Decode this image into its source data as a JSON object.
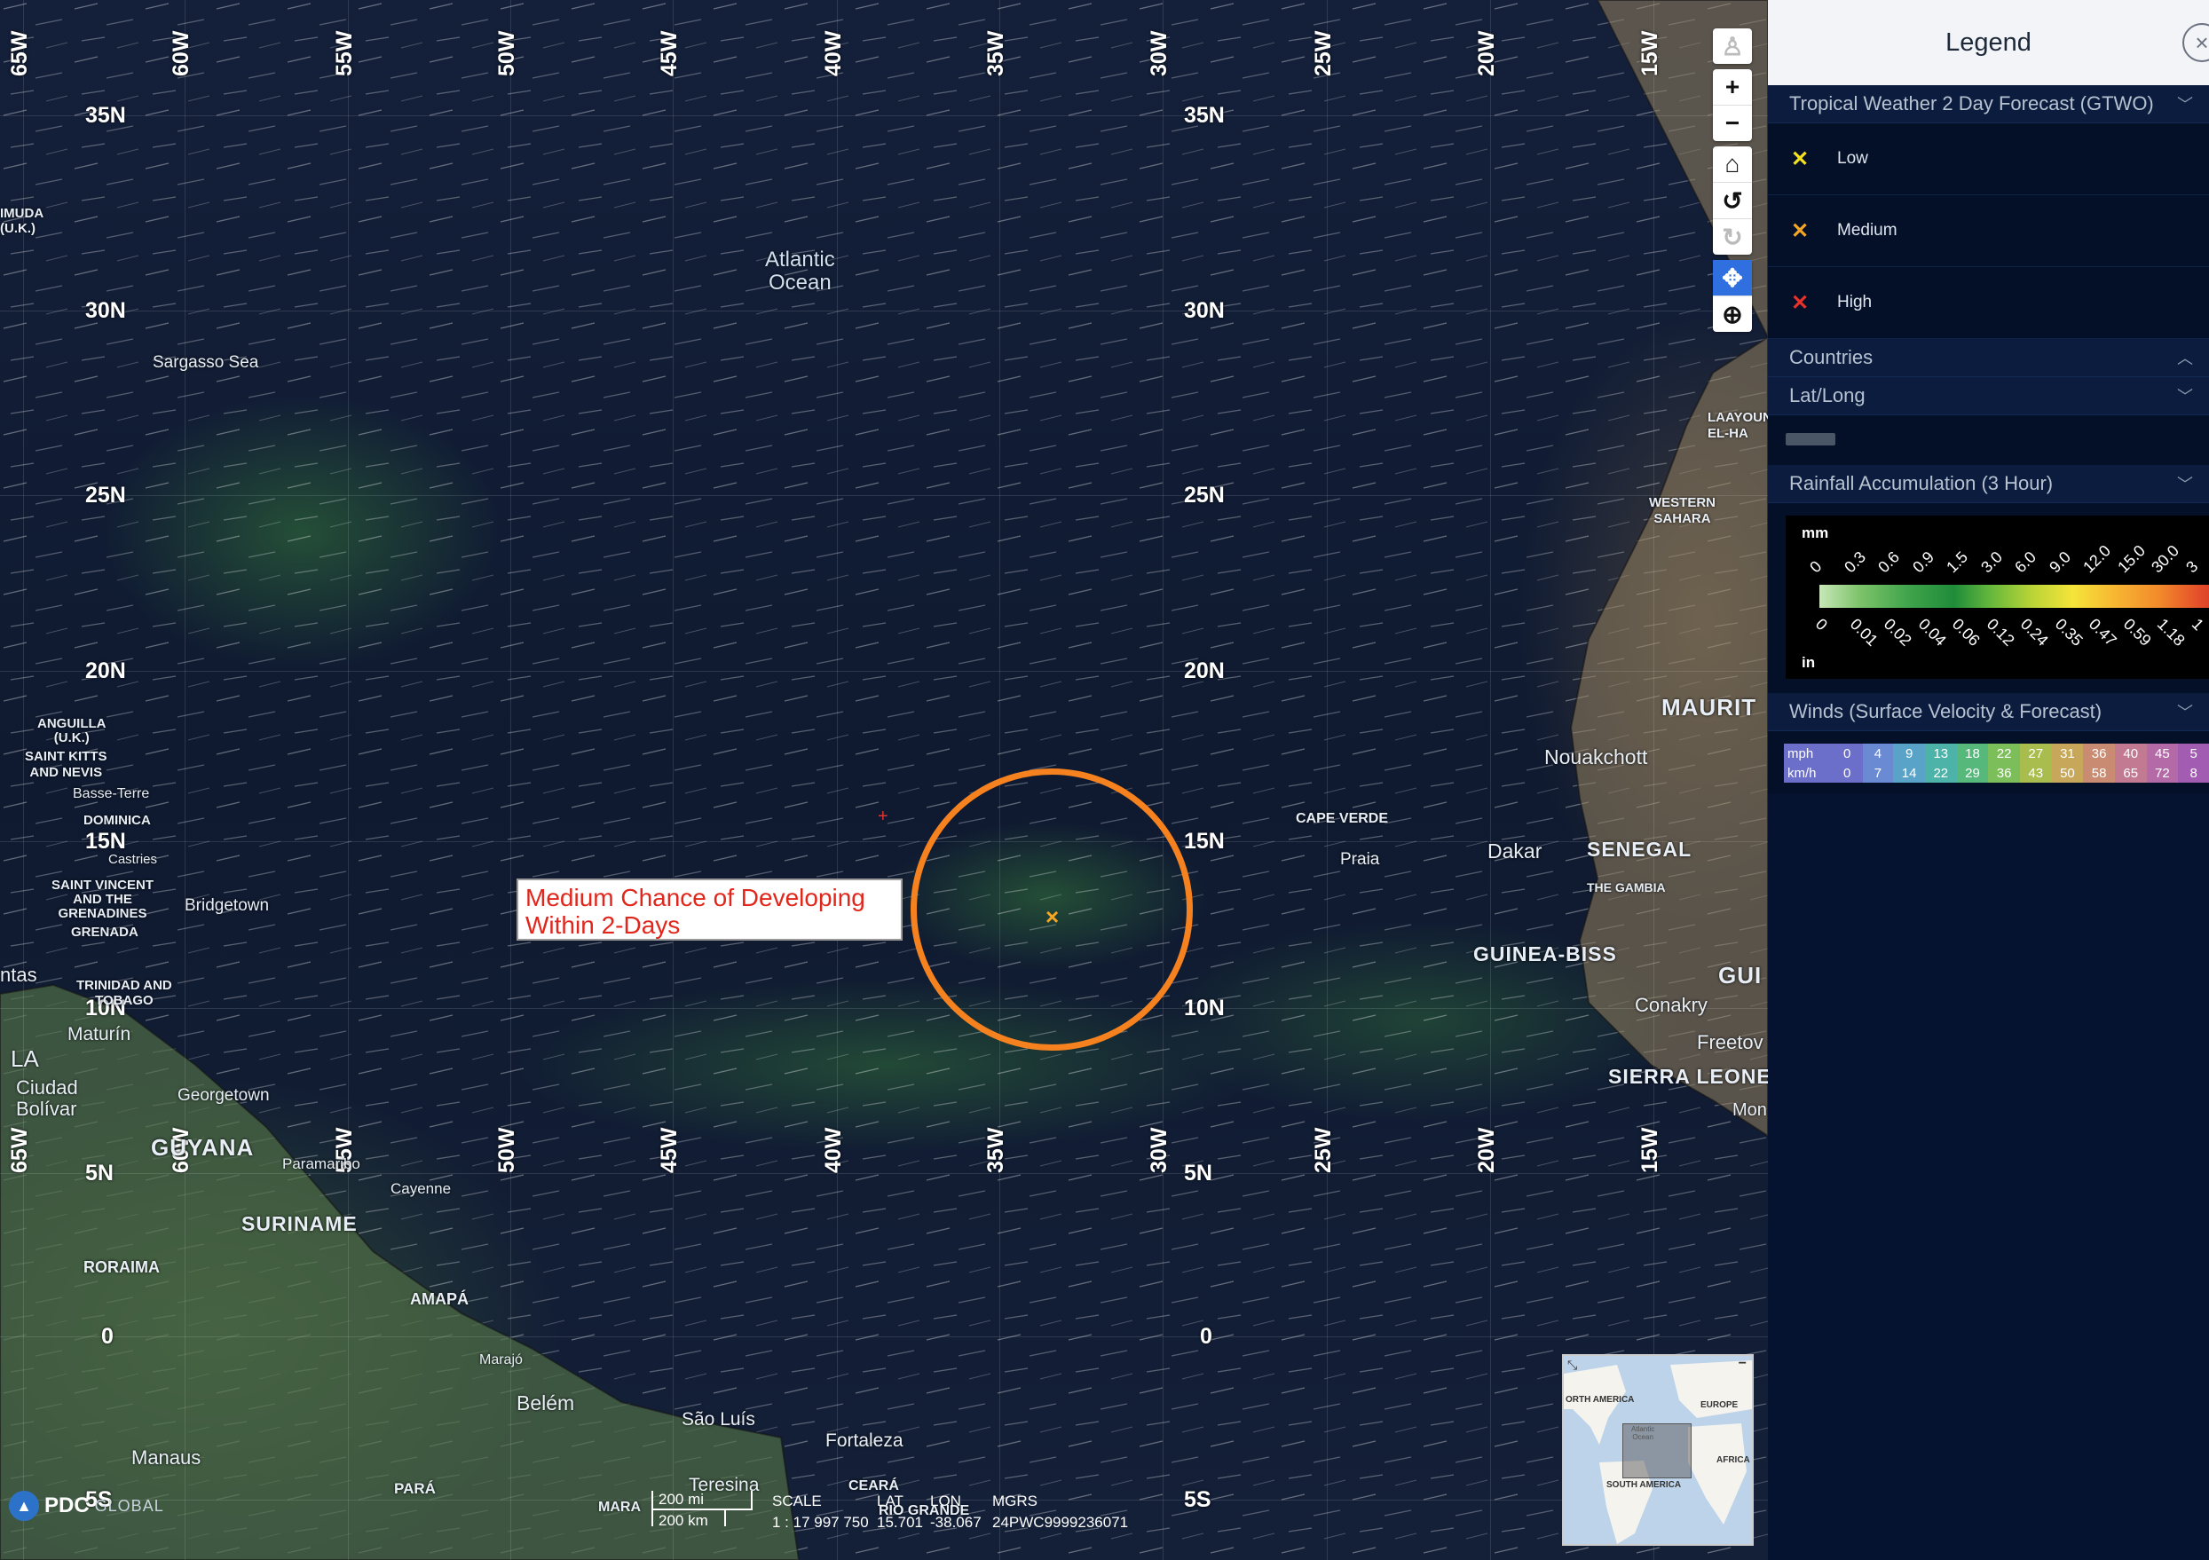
{
  "map": {
    "lat_labels": [
      "35N",
      "30N",
      "25N",
      "20N",
      "15N",
      "10N",
      "5N",
      "0",
      "5S"
    ],
    "lon_labels": [
      "65W",
      "60W",
      "55W",
      "50W",
      "45W",
      "40W",
      "35W",
      "30W",
      "25W",
      "20W",
      "15W"
    ],
    "places": {
      "atlantic_ocean": "Atlantic\nOcean",
      "sargasso_sea": "Sargasso Sea",
      "bermuda": "IMUDA\n(U.K.)",
      "anguilla": "ANGUILLA\n(U.K.)",
      "saint_kitts": "SAINT KITTS\nAND NEVIS",
      "basse_terre": "Basse-Terre",
      "dominica": "DOMINICA",
      "castries": "Castries",
      "saint_vincent": "SAINT VINCENT\nAND THE\nGRENADINES",
      "bridgetown": "Bridgetown",
      "grenada": "GRENADA",
      "trinidad": "TRINIDAD AND\nTOBAGO",
      "ntas": "ntas",
      "la": "LA",
      "maturin": "Maturín",
      "ciudad_bolivar": "Ciudad\nBolívar",
      "georgetown": "Georgetown",
      "guyana": "GUYANA",
      "paramaribo": "Paramaribo",
      "suriname": "SURINAME",
      "cayenne": "Cayenne",
      "roraima": "RORAIMA",
      "amapa": "AMAPÁ",
      "maraja": "Marajó",
      "belem": "Belém",
      "sao_luis": "São Luís",
      "fortaleza": "Fortaleza",
      "teresina": "Teresina",
      "ceara": "CEARÁ",
      "rio_grande": "RIO GRANDE",
      "mara": "MARA",
      "manaus": "Manaus",
      "para": "PARÁ",
      "cape_verde": "CAPE VERDE",
      "praia": "Praia",
      "nouakchott": "Nouakchott",
      "maurit": "MAURIT",
      "dakar": "Dakar",
      "senegal": "SENEGAL",
      "gambia": "THE GAMBIA",
      "guinea_biss": "GUINEA-BISS",
      "gui": "GUI",
      "conakry": "Conakry",
      "freetown": "Freetov",
      "sierra_leone": "SIERRA LEONE",
      "mon": "Mon",
      "western_sahara": "WESTERN\nSAHARA",
      "laayoune": "LAAYOUN\nEL-HA"
    },
    "annotation": "Medium Chance of Developing\nWithin 2-Days",
    "storm_marker": "×",
    "minimap": {
      "north_america": "ORTH AMERICA",
      "europe": "EUROPE",
      "africa": "AFRICA",
      "south_america": "SOUTH AMERICA",
      "atlantic": "Atlantic\nOcean"
    },
    "scale": {
      "miles": "200 mi",
      "km": "200 km",
      "scale_label": "SCALE",
      "scale_value": "1 : 17 997 750",
      "lat_label": "LAT",
      "lat_value": "15.701",
      "lon_label": "LON",
      "lon_value": "-38.067",
      "mgrs_label": "MGRS",
      "mgrs_value": "24PWC9999236071"
    },
    "logo": {
      "name": "PDC",
      "suffix": "GLOBAL"
    }
  },
  "toolbar": {
    "pegman": "♙",
    "zoom_in": "+",
    "zoom_out": "−",
    "home": "⌂",
    "rotate_left": "↺",
    "rotate_right": "↻",
    "pan": "✥",
    "zoom_box": "⊕"
  },
  "legend": {
    "title": "Legend",
    "close": "×",
    "gtwo": {
      "header": "Tropical Weather 2 Day Forecast (GTWO)",
      "items": [
        {
          "label": "Low",
          "color": "#f5e11c"
        },
        {
          "label": "Medium",
          "color": "#f5a623"
        },
        {
          "label": "High",
          "color": "#e8312a"
        }
      ]
    },
    "countries": "Countries",
    "latlong": "Lat/Long",
    "rainfall": {
      "header": "Rainfall Accumulation (3 Hour)",
      "unit_top": "mm",
      "unit_bottom": "in",
      "mm": [
        "0",
        "0.3",
        "0.6",
        "0.9",
        "1.5",
        "3.0",
        "6.0",
        "9.0",
        "12.0",
        "15.0",
        "30.0",
        "3"
      ],
      "in": [
        "0",
        "0.01",
        "0.02",
        "0.04",
        "0.06",
        "0.12",
        "0.24",
        "0.35",
        "0.47",
        "0.59",
        "1.18",
        "1"
      ]
    },
    "winds": {
      "header": "Winds (Surface Velocity & Forecast)",
      "mph_label": "mph",
      "kmh_label": "km/h",
      "mph": [
        "0",
        "4",
        "9",
        "13",
        "18",
        "22",
        "27",
        "31",
        "36",
        "40",
        "45",
        "5"
      ],
      "kmh": [
        "0",
        "7",
        "14",
        "22",
        "29",
        "36",
        "43",
        "50",
        "58",
        "65",
        "72",
        "8"
      ],
      "colors": [
        "#6b6fc9",
        "#6a8ad4",
        "#5aa3c8",
        "#4db3a8",
        "#57b87c",
        "#7cbf5a",
        "#a9bd4e",
        "#c7a75a",
        "#c98c73",
        "#c27a92",
        "#b56aa8",
        "#a25db2"
      ]
    }
  }
}
